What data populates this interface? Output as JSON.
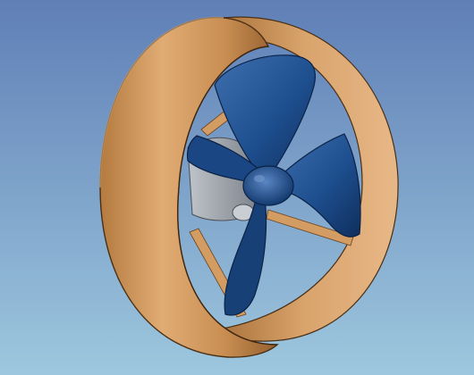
{
  "scene": {
    "subject": "ducted-propeller-model",
    "colors": {
      "background_top": "#5f7fb6",
      "background_bottom": "#9dc7de",
      "duct_light": "#e0ac74",
      "duct_mid": "#c98e52",
      "duct_dark": "#94602f",
      "duct_outline": "#4a2f14",
      "blade_light": "#3f6fae",
      "blade_mid": "#1e4f8f",
      "blade_dark": "#0f2f5e",
      "hub_shaft": "#9aa0a8",
      "strut": "#d29c62"
    }
  }
}
